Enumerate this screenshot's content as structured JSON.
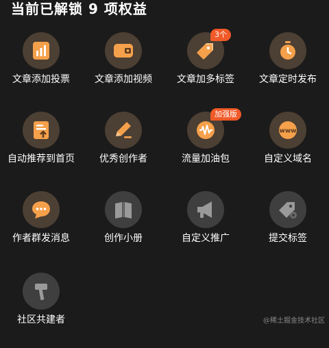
{
  "header": {
    "title": "当前已解锁 9 项权益"
  },
  "benefits": [
    {
      "label": "文章添加投票",
      "icon": "vote-chart-icon"
    },
    {
      "label": "文章添加视频",
      "icon": "video-icon"
    },
    {
      "label": "文章加多标签",
      "icon": "multi-tag-icon",
      "badge": "3个"
    },
    {
      "label": "文章定时发布",
      "icon": "timer-icon"
    },
    {
      "label": "自动推荐到首页",
      "icon": "recommend-doc-icon"
    },
    {
      "label": "优秀创作者",
      "icon": "pencil-icon"
    },
    {
      "label": "流量加油包",
      "icon": "traffic-wave-icon",
      "badge": "加强版"
    },
    {
      "label": "自定义域名",
      "icon": "www-icon"
    },
    {
      "label": "作者群发消息",
      "icon": "chat-bubble-icon"
    },
    {
      "label": "创作小册",
      "icon": "booklet-icon"
    },
    {
      "label": "自定义推广",
      "icon": "megaphone-icon"
    },
    {
      "label": "提交标签",
      "icon": "tag-settings-icon"
    },
    {
      "label": "社区共建者",
      "icon": "hammer-icon"
    }
  ],
  "colors": {
    "accent": "#f5a04b",
    "badge": "#f05a28",
    "unlocked_bg": "#4c3f33",
    "locked_bg": "#3f3f3f",
    "locked_icon": "#9a9a9a"
  },
  "watermark": "@稀土掘金技术社区"
}
